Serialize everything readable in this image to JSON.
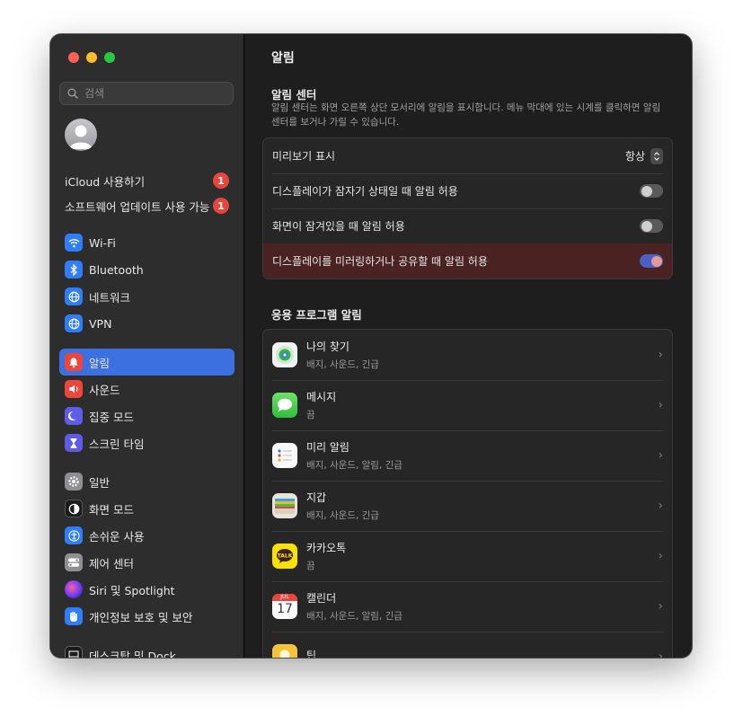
{
  "sidebar": {
    "search_placeholder": "검색",
    "account_items": [
      {
        "label": "iCloud 사용하기",
        "badge": "1"
      },
      {
        "label": "소프트웨어 업데이트 사용 가능",
        "badge": "1"
      }
    ],
    "items": [
      {
        "label": "Wi-Fi",
        "icon": "wifi-icon",
        "color": "#2f7ef5"
      },
      {
        "label": "Bluetooth",
        "icon": "bluetooth-icon",
        "color": "#2f7ef5"
      },
      {
        "label": "네트워크",
        "icon": "globe-icon",
        "color": "#2f7ef5"
      },
      {
        "label": "VPN",
        "icon": "vpn-globe-icon",
        "color": "#2f7ef5"
      },
      {
        "label": "알림",
        "icon": "bell-icon",
        "color": "#f0453a",
        "selected": true
      },
      {
        "label": "사운드",
        "icon": "speaker-icon",
        "color": "#f0453a"
      },
      {
        "label": "집중 모드",
        "icon": "moon-icon",
        "color": "#5e5ce6"
      },
      {
        "label": "스크린 타임",
        "icon": "hourglass-icon",
        "color": "#5e5ce6"
      },
      {
        "label": "일반",
        "icon": "gear-icon",
        "color": "#8e8e93"
      },
      {
        "label": "화면 모드",
        "icon": "appearance-icon",
        "color": "#1c1c1e"
      },
      {
        "label": "손쉬운 사용",
        "icon": "accessibility-icon",
        "color": "#2f7ef5"
      },
      {
        "label": "제어 센터",
        "icon": "control-center-icon",
        "color": "#8e8e93"
      },
      {
        "label": "Siri 및 Spotlight",
        "icon": "siri-icon",
        "color": "#8a3ffc"
      },
      {
        "label": "개인정보 보호 및 보안",
        "icon": "hand-icon",
        "color": "#2f7ef5"
      },
      {
        "label": "데스크탑 및 Dock",
        "icon": "dock-icon",
        "color": "#1c1c1e"
      }
    ]
  },
  "main": {
    "title": "알림",
    "notification_center": {
      "title": "알림 센터",
      "description": "알림 센터는 화면 오른쪽 상단 모서리에 알림을 표시합니다. 메뉴 막대에 있는 시계를 클릭하면 알림 센터를 보거나 가릴 수 있습니다.",
      "rows": [
        {
          "label": "미리보기 표시",
          "value": "항상",
          "type": "select"
        },
        {
          "label": "디스플레이가 잠자기 상태일 때 알림 허용",
          "type": "toggle",
          "on": false
        },
        {
          "label": "화면이 잠겨있을 때 알림 허용",
          "type": "toggle",
          "on": false
        },
        {
          "label": "디스플레이를 미러링하거나 공유할 때 알림 허용",
          "type": "toggle",
          "on": true
        }
      ]
    },
    "app_notifications": {
      "title": "응용 프로그램 알림",
      "apps": [
        {
          "name": "나의 찾기",
          "detail": "배지, 사운드, 긴급",
          "icon": "find-my-icon"
        },
        {
          "name": "메시지",
          "detail": "끔",
          "icon": "messages-icon"
        },
        {
          "name": "미리 알림",
          "detail": "배지, 사운드, 알림, 긴급",
          "icon": "reminders-icon"
        },
        {
          "name": "지갑",
          "detail": "배지, 사운드, 긴급",
          "icon": "wallet-icon"
        },
        {
          "name": "카카오톡",
          "detail": "끔",
          "icon": "kakaotalk-icon"
        },
        {
          "name": "캘린더",
          "detail": "배지, 사운드, 알림, 긴급",
          "icon": "calendar-icon",
          "cal_month": "JUL",
          "cal_day": "17"
        },
        {
          "name": "팁",
          "detail": "",
          "icon": "tips-icon"
        }
      ]
    }
  },
  "colors": {
    "accent": "#3c6fe0",
    "badge": "#e8453c",
    "highlight_row": "#4a2222"
  }
}
